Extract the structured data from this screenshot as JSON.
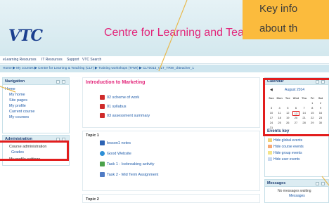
{
  "header": {
    "logo_text": "VTC",
    "site_title": "Centre for Learning and Teach"
  },
  "callout": {
    "line1": "Key info",
    "line2": "about th"
  },
  "navbar": {
    "items": [
      "eLearning Resources",
      "IT Resources",
      "Support",
      "VTC Search"
    ]
  },
  "breadcrumb": {
    "text": "Home ▶ My courses ▶ Centre for Learning & Teaching (CLT) ▶ Training workshops (TRW) ▶ CLT0013_CLT_TRW_cltteacher_1"
  },
  "navigation": {
    "title": "Navigation",
    "items": [
      "Home",
      "My home",
      "Site pages",
      "My profile",
      "Current course",
      "My courses"
    ]
  },
  "administration": {
    "title": "Administration",
    "items": [
      "Course administration",
      "Grades",
      "My profile settings"
    ]
  },
  "sections": [
    {
      "title": "Introduction to Marketing",
      "resources": [
        {
          "label": "02 scheme of work",
          "icon": "pdf-icon"
        },
        {
          "label": "01 syllabus",
          "icon": "pdf-icon"
        },
        {
          "label": "03 assessment summary",
          "icon": "pdf-icon"
        }
      ]
    },
    {
      "title": "Topic 1",
      "resources": [
        {
          "label": "lesson1 notes",
          "icon": "document-icon"
        },
        {
          "label": "Good Website",
          "icon": "web-link-icon"
        },
        {
          "label": "Task 1 - Icebreaking activity",
          "icon": "forum-icon"
        },
        {
          "label": "Task 2 - Mid Term Assignment",
          "icon": "assignment-icon"
        }
      ]
    },
    {
      "title": "Topic 2",
      "resources": []
    }
  ],
  "calendar": {
    "title": "Calendar",
    "month": "August 2014",
    "days_header": [
      "Sun",
      "Mon",
      "Tue",
      "Wed",
      "Thu",
      "Fri",
      "Sat"
    ],
    "weeks": [
      [
        "",
        "",
        "",
        "",
        "",
        "1",
        "2"
      ],
      [
        "3",
        "4",
        "5",
        "6",
        "7",
        "8",
        "9"
      ],
      [
        "10",
        "11",
        "12",
        "13",
        "14",
        "15",
        "16"
      ],
      [
        "17",
        "18",
        "19",
        "20",
        "21",
        "22",
        "23"
      ],
      [
        "24",
        "25",
        "26",
        "27",
        "28",
        "29",
        "30"
      ],
      [
        "31",
        "",
        "",
        "",
        "",
        "",
        ""
      ]
    ],
    "today": "13",
    "events_key_title": "Events key",
    "events": [
      {
        "label": "Hide global events",
        "color": "#f0d27a"
      },
      {
        "label": "Hide course events",
        "color": "#f6a873"
      },
      {
        "label": "Hide group events",
        "color": "#f3e38a"
      },
      {
        "label": "Hide user events",
        "color": "#c6d8f0"
      }
    ]
  },
  "messages": {
    "title": "Messages",
    "empty_text": "No messages waiting",
    "link_text": "Messages"
  },
  "colors": {
    "brand_pink": "#e2267a",
    "brand_blue": "#1b3f8f",
    "highlight_red": "#e21d1d",
    "callout_orange": "#fbbb3d"
  }
}
